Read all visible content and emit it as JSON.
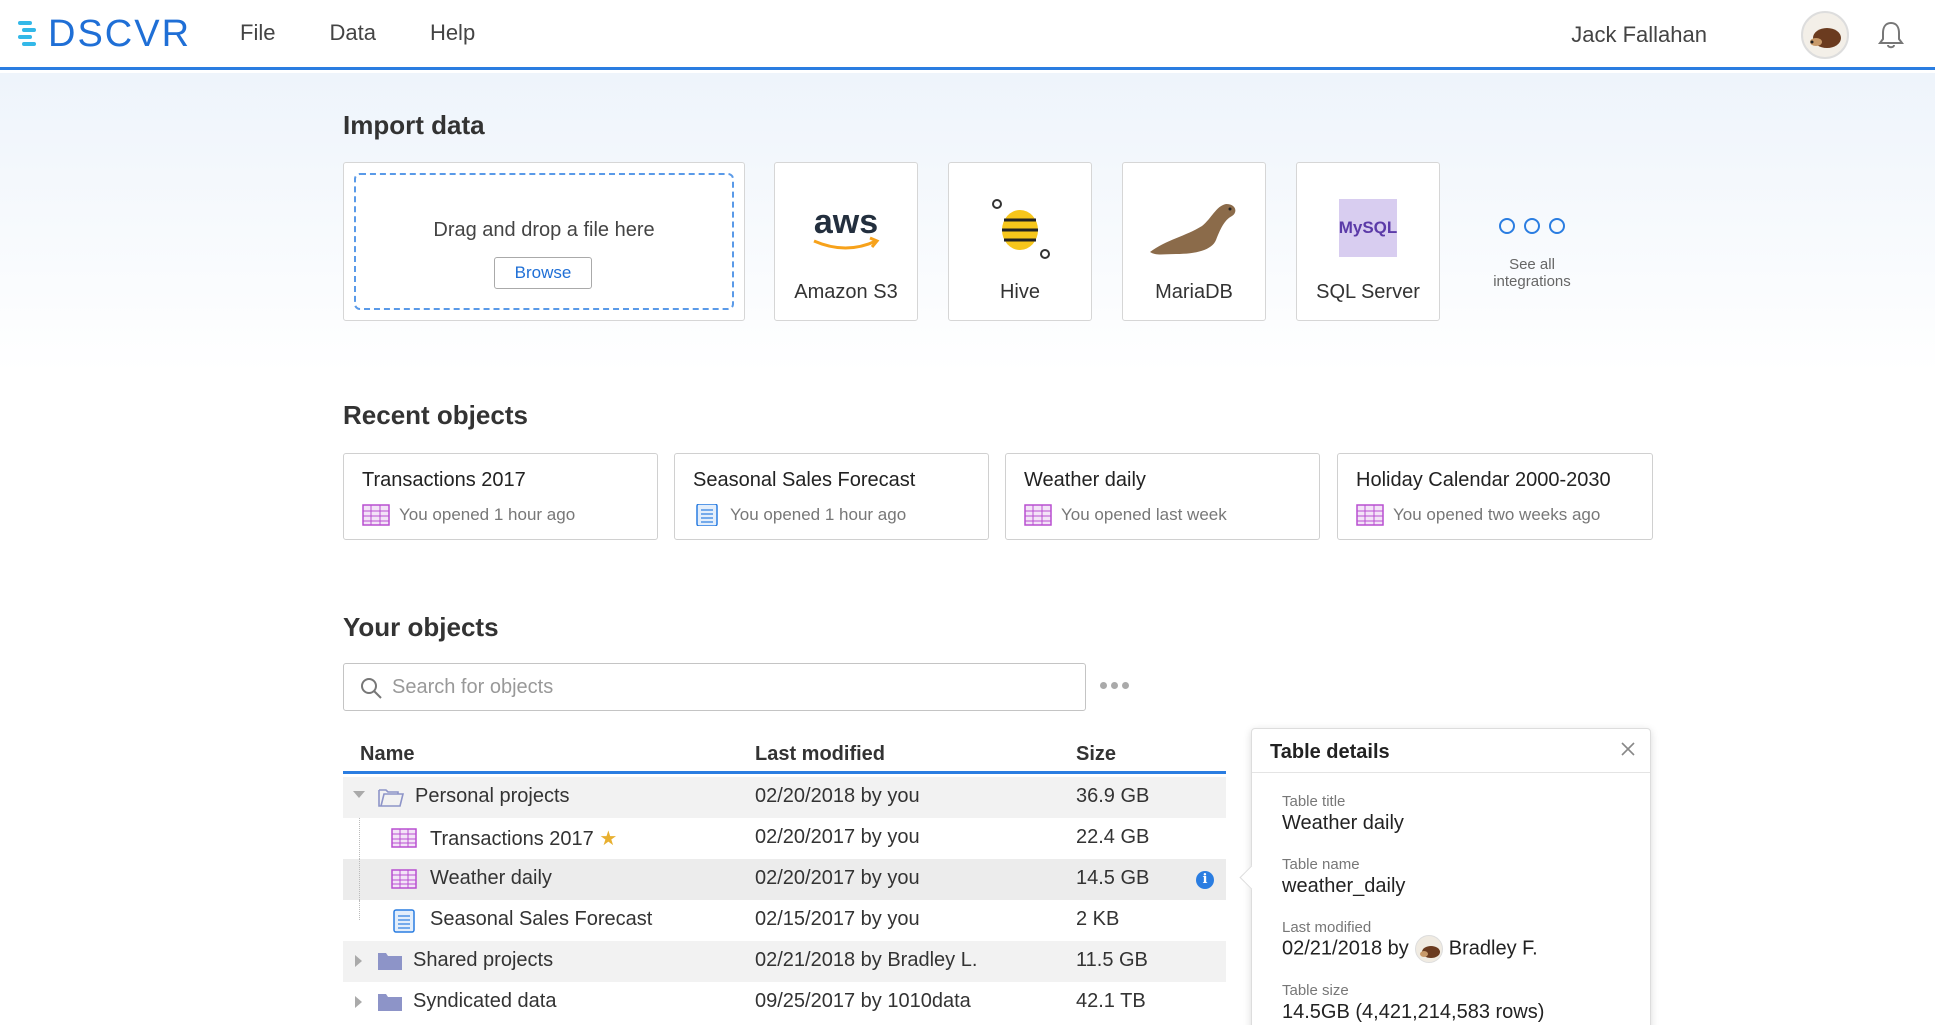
{
  "app": {
    "logo": "DSCVR"
  },
  "nav": {
    "items": [
      "File",
      "Data",
      "Help"
    ]
  },
  "user": {
    "name": "Jack Fallahan"
  },
  "import": {
    "title": "Import data",
    "drop_text": "Drag and drop a file here",
    "browse_label": "Browse",
    "integrations": [
      {
        "label": "Amazon S3",
        "logo_text": "aws",
        "icon": "aws-icon"
      },
      {
        "label": "Hive",
        "icon": "hive-icon"
      },
      {
        "label": "MariaDB",
        "icon": "mariadb-seal-icon"
      },
      {
        "label": "SQL Server",
        "logo_text": "MySQL",
        "icon": "mysql-icon"
      }
    ],
    "see_all_line1": "See all",
    "see_all_line2": "integrations"
  },
  "recent": {
    "title": "Recent objects",
    "items": [
      {
        "title": "Transactions 2017",
        "subtitle": "You opened 1 hour ago",
        "icon": "table-icon"
      },
      {
        "title": "Seasonal Sales Forecast",
        "subtitle": "You opened 1 hour ago",
        "icon": "spreadsheet-icon"
      },
      {
        "title": "Weather daily",
        "subtitle": "You opened last week",
        "icon": "table-icon"
      },
      {
        "title": "Holiday Calendar 2000-2030",
        "subtitle": "You opened two weeks ago",
        "icon": "table-icon"
      }
    ]
  },
  "objects": {
    "title": "Your objects",
    "search_placeholder": "Search for objects",
    "columns": {
      "name": "Name",
      "modified": "Last modified",
      "size": "Size"
    },
    "rows": [
      {
        "name": "Personal projects",
        "modified": "02/20/2018 by you",
        "size": "36.9 GB",
        "icon": "folder-open-icon"
      },
      {
        "name": "Transactions 2017",
        "modified": "02/20/2017 by you",
        "size": "22.4 GB",
        "icon": "table-icon",
        "starred": "★"
      },
      {
        "name": "Weather daily",
        "modified": "02/20/2017 by you",
        "size": "14.5 GB",
        "icon": "table-icon",
        "info": "i"
      },
      {
        "name": "Seasonal Sales Forecast",
        "modified": "02/15/2017 by you",
        "size": "2 KB",
        "icon": "spreadsheet-icon"
      },
      {
        "name": "Shared projects",
        "modified": "02/21/2018 by Bradley L.",
        "size": "11.5 GB",
        "icon": "folder-icon"
      },
      {
        "name": "Syndicated data",
        "modified": "09/25/2017 by 1010data",
        "size": "42.1 TB",
        "icon": "folder-icon"
      }
    ]
  },
  "details": {
    "title": "Table details",
    "fields": [
      {
        "label": "Table title",
        "value": "Weather daily"
      },
      {
        "label": "Table name",
        "value": "weather_daily"
      },
      {
        "label": "Last modified",
        "value_prefix": "02/21/2018 by",
        "value_user": "Bradley F."
      },
      {
        "label": "Table size",
        "value": "14.5GB (4,421,214,583 rows)"
      }
    ]
  },
  "colors": {
    "accent": "#2a7de1",
    "table_icon": "#b84fd0",
    "folder": "#8d94c8"
  }
}
